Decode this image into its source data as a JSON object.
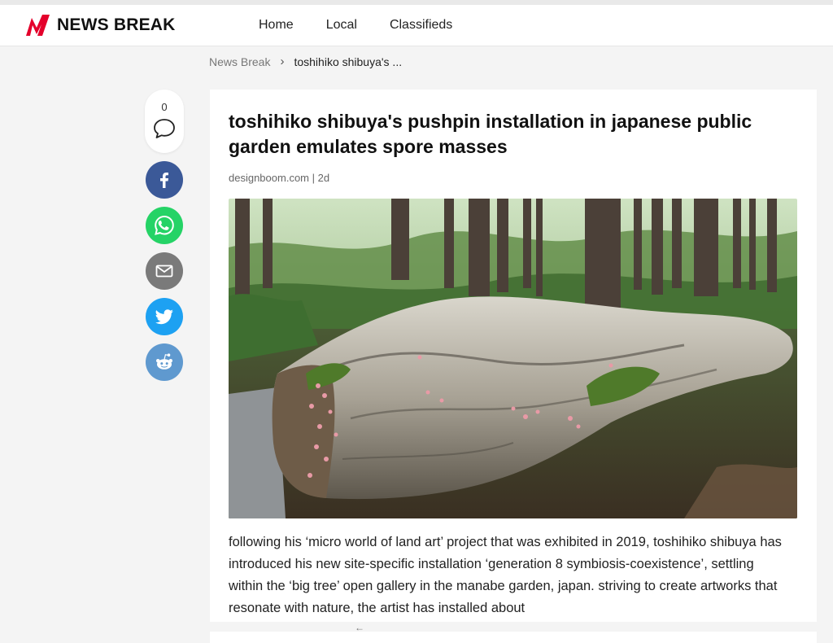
{
  "brand": {
    "name": "NEWS BREAK",
    "accent": "#e4002b"
  },
  "nav": [
    {
      "label": "Home"
    },
    {
      "label": "Local"
    },
    {
      "label": "Classifieds"
    }
  ],
  "breadcrumb": {
    "root": "News Break",
    "separator": "›",
    "current": "toshihiko shibuya's ..."
  },
  "share": {
    "comment_count": "0",
    "buttons": [
      {
        "icon": "facebook-icon",
        "color": "#3b5998"
      },
      {
        "icon": "whatsapp-icon",
        "color": "#25d366"
      },
      {
        "icon": "email-icon",
        "color": "#7a7a7a"
      },
      {
        "icon": "twitter-icon",
        "color": "#1da1f2"
      },
      {
        "icon": "reddit-icon",
        "color": "#5f99cf"
      }
    ]
  },
  "article": {
    "title": "toshihiko shibuya's pushpin installation in japanese public garden emulates spore masses",
    "source": "designboom.com",
    "meta_separator": "|",
    "age": "2d",
    "body": "following his ‘micro world of land art’ project that was exhibited in 2019, toshihiko shibuya has introduced his new site-specific installation ‘generation 8 symbiosis-coexistence’, settling within the ‘big tree’ open gallery in the manabe garden, japan. striving to create artworks that resonate with nature, the artist has installed about"
  },
  "footer": {
    "arrow": "←"
  }
}
